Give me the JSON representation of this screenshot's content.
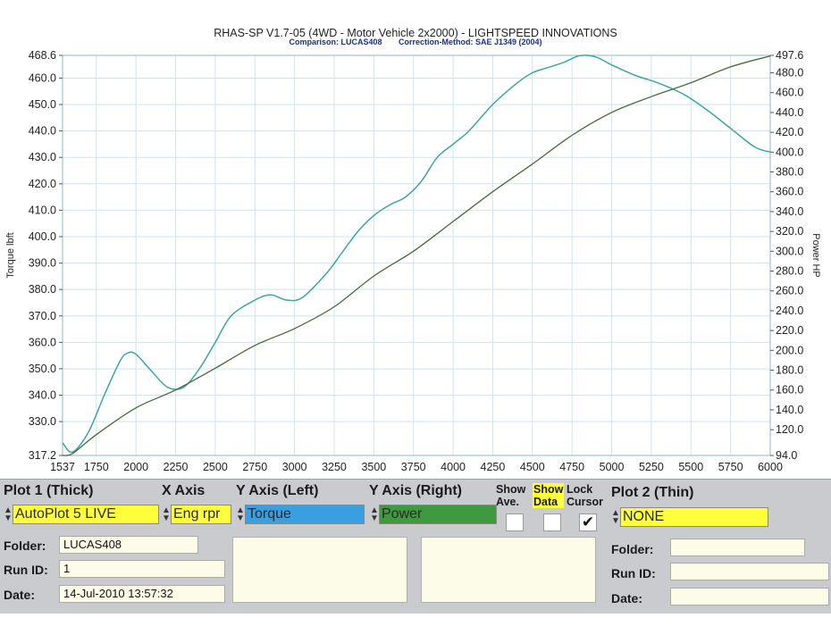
{
  "title": "RHAS-SP V1.7-05   (4WD - Motor Vehicle 2x2000) - LIGHTSPEED INNOVATIONS",
  "subtitle": {
    "comparison": "Comparison: LUCAS408",
    "correction": "Correction-Method: SAE J1349 (2004)"
  },
  "colors": {
    "torque": "#3aa8a0",
    "power": "#4a6a3a",
    "grid": "#cfe3ef",
    "panel": "#c9cbcf",
    "yellow": "#ffff3c",
    "blue": "#3a9fe0",
    "green": "#3f9a3f"
  },
  "chart_data": {
    "type": "line",
    "title": "RHAS-SP V1.7-05   (4WD - Motor Vehicle 2x2000) - LIGHTSPEED INNOVATIONS",
    "xlabel": "",
    "ylabel": "Torque lbft",
    "y2label": "Power HP",
    "xlim": [
      1537,
      6000
    ],
    "ylim": [
      317.2,
      468.6
    ],
    "y2lim": [
      94.0,
      497.6
    ],
    "x_ticks": [
      "1537",
      "1750",
      "2000",
      "2250",
      "2500",
      "2750",
      "3000",
      "3250",
      "3500",
      "3750",
      "4000",
      "4250",
      "4500",
      "4750",
      "5000",
      "5250",
      "5500",
      "5750",
      "6000"
    ],
    "y_ticks": [
      "468.6",
      "460.0",
      "450.0",
      "440.0",
      "430.0",
      "420.0",
      "410.0",
      "400.0",
      "390.0",
      "380.0",
      "370.0",
      "360.0",
      "350.0",
      "340.0",
      "330.0",
      "317.2"
    ],
    "y2_ticks": [
      "497.6",
      "480.0",
      "460.0",
      "440.0",
      "420.0",
      "400.0",
      "380.0",
      "360.0",
      "340.0",
      "320.0",
      "300.0",
      "280.0",
      "260.0",
      "240.0",
      "220.0",
      "200.0",
      "180.0",
      "160.0",
      "140.0",
      "120.0",
      "94.0"
    ],
    "grid": true,
    "legend": "none",
    "series": [
      {
        "name": "Torque",
        "axis": "left",
        "x": [
          1537,
          1600,
          1700,
          1800,
          1900,
          1950,
          2000,
          2100,
          2200,
          2300,
          2400,
          2500,
          2600,
          2750,
          2850,
          2950,
          3050,
          3200,
          3300,
          3400,
          3500,
          3600,
          3700,
          3800,
          3900,
          4000,
          4100,
          4250,
          4400,
          4500,
          4600,
          4700,
          4800,
          4900,
          5000,
          5150,
          5300,
          5450,
          5600,
          5750,
          5900,
          6000
        ],
        "values": [
          322,
          318.5,
          326,
          340,
          353,
          356,
          355.5,
          349,
          343,
          343,
          350,
          360,
          370,
          376,
          378,
          376,
          377,
          386,
          394,
          402,
          408,
          412,
          415,
          421,
          430,
          435,
          440,
          450,
          458,
          462,
          464,
          466,
          468.5,
          468,
          465,
          461,
          458,
          454,
          448,
          441,
          434,
          432
        ]
      },
      {
        "name": "Power",
        "axis": "right",
        "x": [
          1537,
          1600,
          1750,
          2000,
          2250,
          2500,
          2750,
          3000,
          3250,
          3500,
          3750,
          4000,
          4250,
          4500,
          4750,
          5000,
          5250,
          5500,
          5750,
          6000
        ],
        "values": [
          94,
          96,
          115,
          142,
          160,
          182,
          205,
          222,
          244,
          275,
          300,
          330,
          360,
          388,
          417,
          440,
          456,
          470,
          486,
          497
        ]
      }
    ]
  },
  "controls": {
    "plot1_header": "Plot 1 (Thick)",
    "xaxis_header": "X Axis",
    "yaxis_left_header": "Y Axis (Left)",
    "yaxis_right_header": "Y Axis (Right)",
    "show_ave_label_1": "Show",
    "show_ave_label_2": "Ave.",
    "show_data_label_1": "Show",
    "show_data_label_2": "Data",
    "lock_cursor_label_1": "Lock",
    "lock_cursor_label_2": "Cursor",
    "plot2_header": "Plot 2 (Thin)",
    "plot1_select": "AutoPlot 5 LIVE",
    "xaxis_select": "Eng rpr",
    "yleft_select": "Torque",
    "yright_select": "Power",
    "plot2_select": "NONE",
    "lock_cursor_checked": "✔",
    "folder_label": "Folder:",
    "runid_label": "Run ID:",
    "date_label": "Date:",
    "folder_value": "LUCAS408",
    "runid_value": "1",
    "date_value": "14-Jul-2010  13:57:32",
    "folder2_label": "Folder:",
    "runid2_label": "Run ID:",
    "date2_label": "Date:"
  }
}
